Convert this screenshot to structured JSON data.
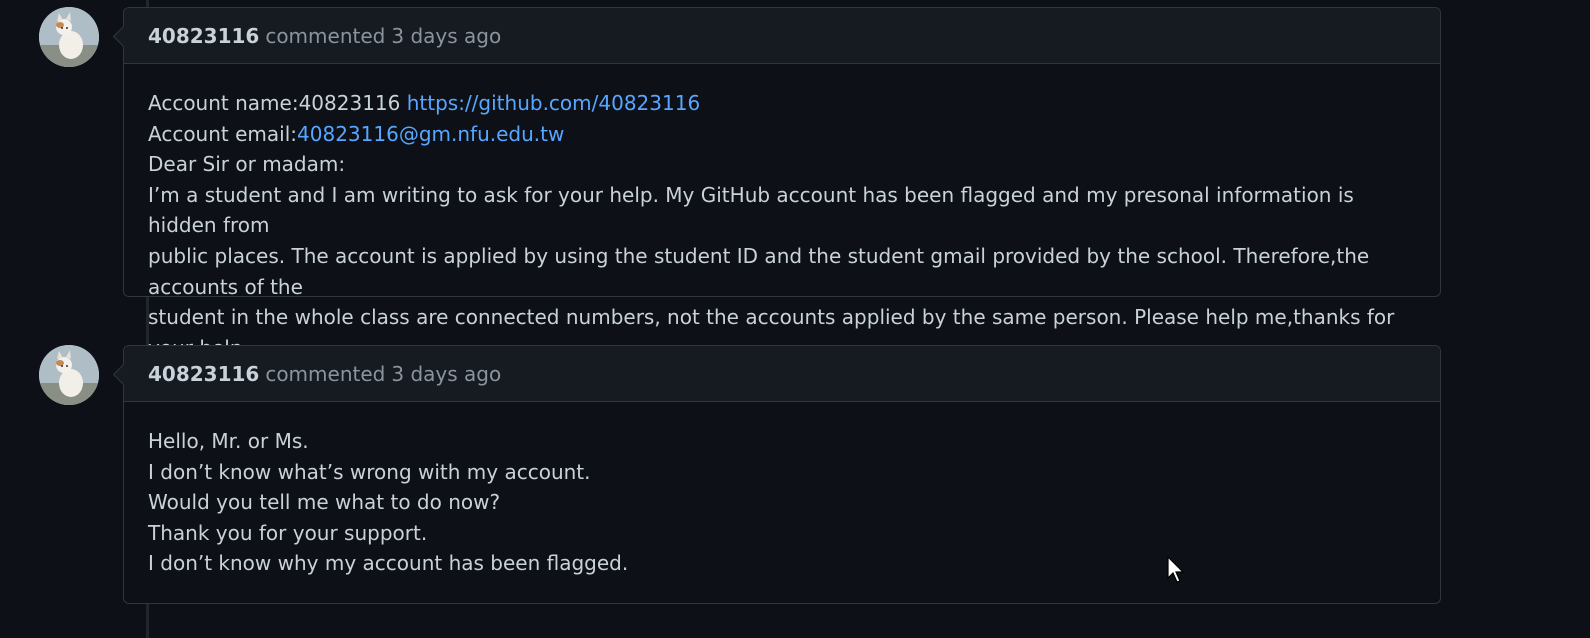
{
  "comments": [
    {
      "author": "40823116",
      "action": "commented",
      "timestamp": "3 days ago",
      "avatar_icon": "white-cat-avatar",
      "body": {
        "account_name_label": "Account name:40823116",
        "account_link": "https://github.com/40823116",
        "account_email_label": "Account email:",
        "account_email_link": "40823116@gm.nfu.edu.tw",
        "greeting": "Dear Sir or madam:",
        "paragraph_lines": [
          "I’m a student and I am writing to ask for your help. My GitHub account has been flagged and my presonal information is hidden from",
          "public places. The account is applied by using the student ID and the student gmail provided by the school. Therefore,the accounts of the",
          "student in the whole class are connected numbers, not the accounts applied by the same person. Please help me,thanks for your help."
        ]
      }
    },
    {
      "author": "40823116",
      "action": "commented",
      "timestamp": "3 days ago",
      "avatar_icon": "white-cat-avatar",
      "body": {
        "lines": [
          "Hello, Mr. or Ms.",
          "I don’t know what’s wrong with my account.",
          "Would you tell me what to do now?",
          "Thank you for your support.",
          "I don’t know why my account has been flagged."
        ]
      }
    }
  ],
  "colors": {
    "background": "#0d1117",
    "header_bg": "#161b22",
    "border": "#30363d",
    "link": "#58a6ff",
    "text": "#c9d1d9",
    "muted": "#8b949e"
  }
}
